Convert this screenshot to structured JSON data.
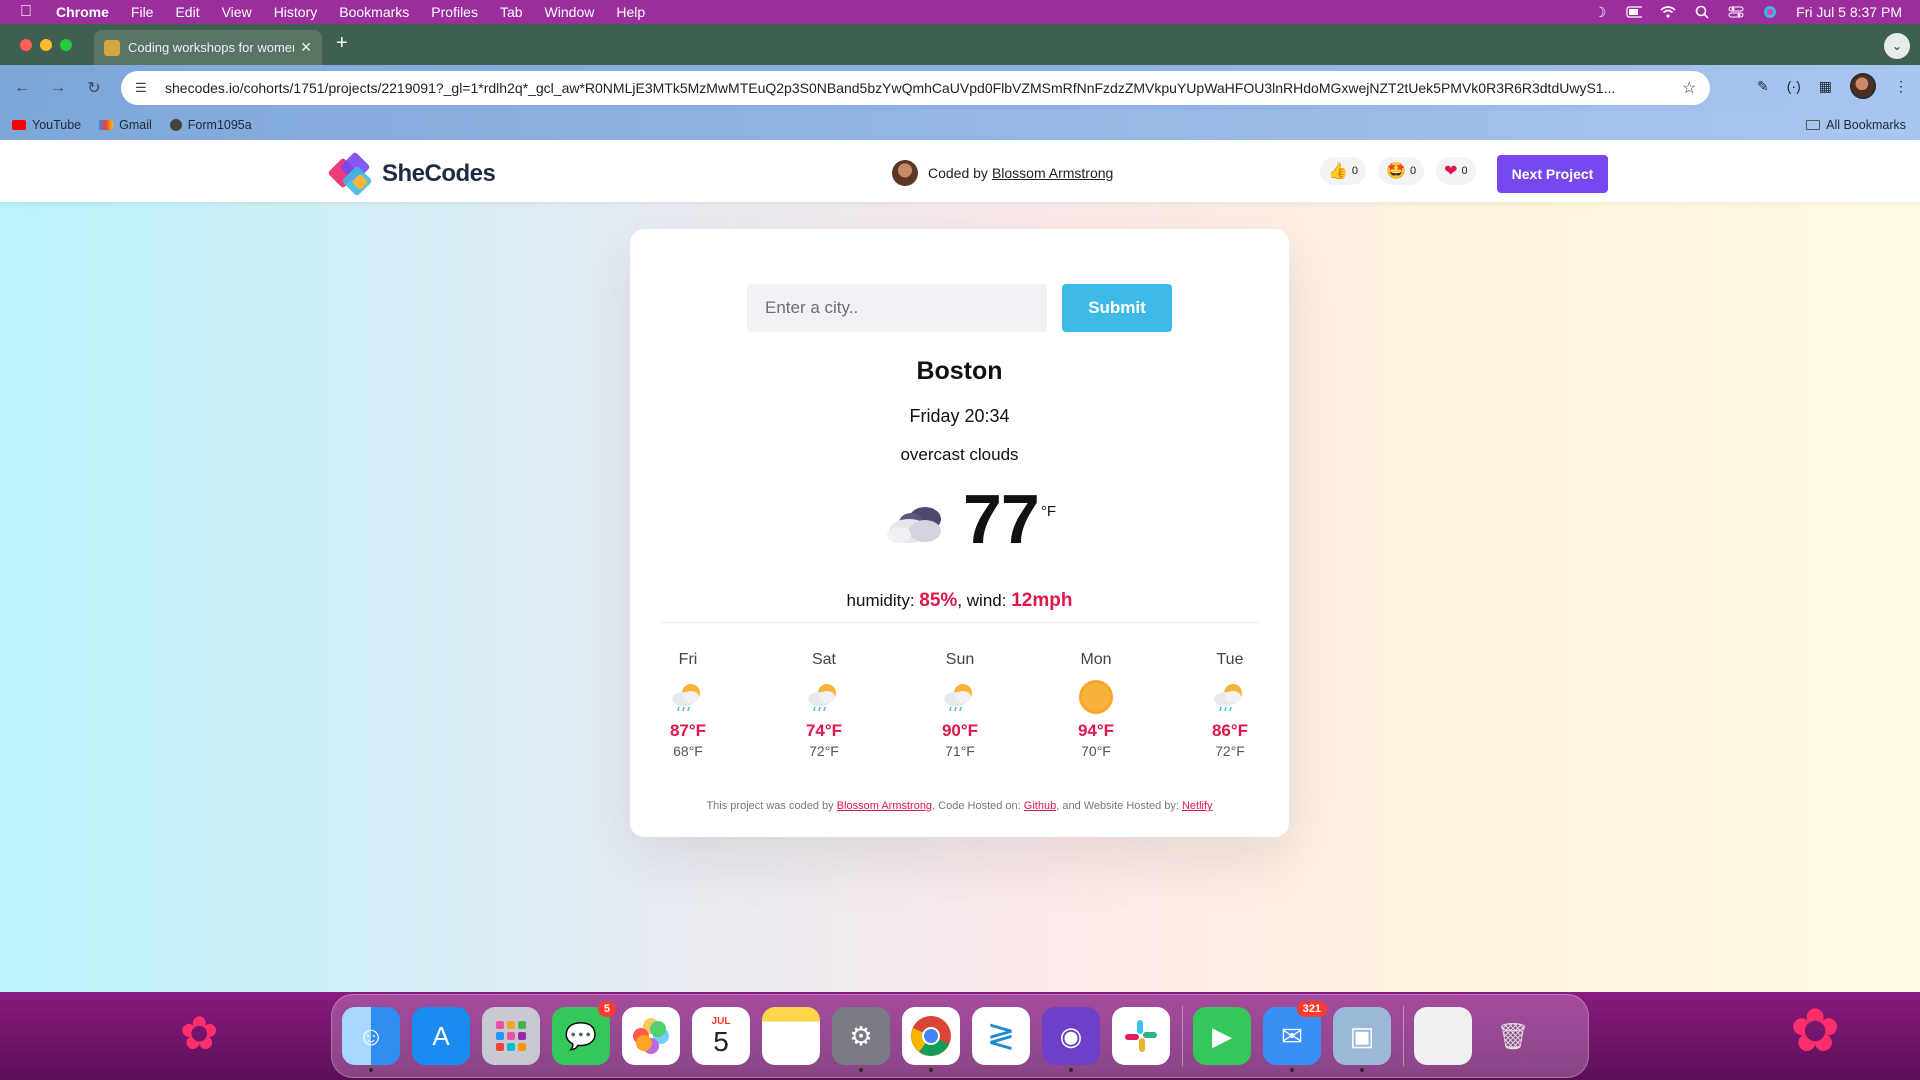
{
  "menubar": {
    "app_name": "Chrome",
    "items": [
      "File",
      "Edit",
      "View",
      "History",
      "Bookmarks",
      "Profiles",
      "Tab",
      "Window",
      "Help"
    ],
    "clock": "Fri Jul 5  8:37 PM"
  },
  "browser": {
    "tab_title": "Coding workshops for women",
    "url": "shecodes.io/cohorts/1751/projects/2219091?_gl=1*rdlh2q*_gcl_aw*R0NMLjE3MTk5MzMwMTEuQ2p3S0NBand5bzYwQmhCaUVpd0FlbVZMSmRfNnFzdzZMVkpuYUpWaHFOU3lnRHdoMGxwejNZT2tUek5PMVk0R3R6R3dtdUwyS1...",
    "bookmarks": [
      "YouTube",
      "Gmail",
      "Form1095a"
    ],
    "all_bookmarks": "All Bookmarks"
  },
  "shecodes": {
    "logo_text": "SheCodes",
    "coded_by_label": "Coded by",
    "author": "Blossom Armstrong",
    "reactions": [
      {
        "icon": "thumbs-up",
        "count": "0"
      },
      {
        "icon": "star-struck",
        "count": "0"
      },
      {
        "icon": "heart",
        "count": "0"
      }
    ],
    "next_project": "Next Project"
  },
  "weather": {
    "search_placeholder": "Enter a city..",
    "submit_label": "Submit",
    "city": "Boston",
    "datetime": "Friday 20:34",
    "description": "overcast clouds",
    "temperature": "77",
    "unit": "°F",
    "humidity_label": "humidity:",
    "humidity": "85%",
    "wind_label": ", wind:",
    "wind": "12mph",
    "forecast": [
      {
        "day": "Fri",
        "icon": "sun-rain-icon",
        "high": "87°F",
        "low": "68°F"
      },
      {
        "day": "Sat",
        "icon": "sun-rain-icon",
        "high": "74°F",
        "low": "72°F"
      },
      {
        "day": "Sun",
        "icon": "sun-rain-icon",
        "high": "90°F",
        "low": "71°F"
      },
      {
        "day": "Mon",
        "icon": "sun-icon",
        "high": "94°F",
        "low": "70°F"
      },
      {
        "day": "Tue",
        "icon": "sun-rain-icon",
        "high": "86°F",
        "low": "72°F"
      }
    ],
    "credits": {
      "prefix": "This project was coded by ",
      "author": "Blossom Armstrong",
      "mid1": ", Code Hosted on: ",
      "host1": "Github",
      "mid2": ", and Website Hosted by: ",
      "host2": "Netlify"
    }
  },
  "dock": {
    "messages_badge": "5",
    "calendar_month": "JUL",
    "calendar_day": "5",
    "mail_badge": "321"
  },
  "colors": {
    "accent_red": "#e0174b",
    "submit_blue": "#3dbbe6",
    "next_purple": "#7747f0"
  }
}
